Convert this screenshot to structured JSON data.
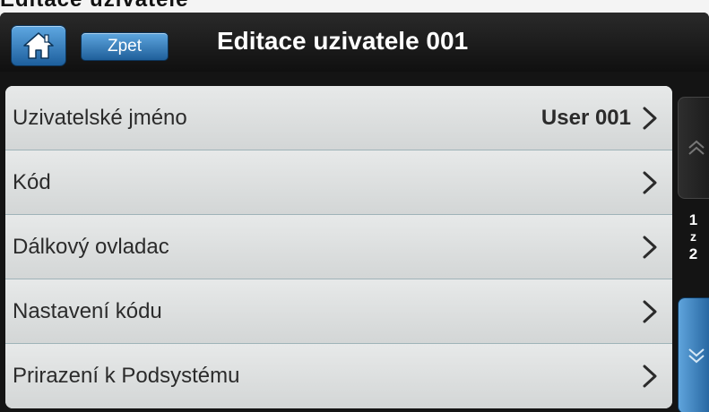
{
  "top_text": "Editace uzivatele",
  "header": {
    "home_icon": "home-icon",
    "back_label": "Zpet",
    "title": "Editace uzivatele 001"
  },
  "list": {
    "items": [
      {
        "label": "Uzivatelské jméno",
        "value": "User 001"
      },
      {
        "label": "Kód",
        "value": ""
      },
      {
        "label": "Dálkový ovladac",
        "value": ""
      },
      {
        "label": "Nastavení kódu",
        "value": ""
      },
      {
        "label": "Prirazení k Podsystému",
        "value": ""
      }
    ]
  },
  "pager": {
    "current": "1",
    "separator": "z",
    "total": "2"
  },
  "colors": {
    "accent_blue": "#1f5f9a",
    "row_background": "#dfe1e1",
    "header_background": "#141414"
  }
}
